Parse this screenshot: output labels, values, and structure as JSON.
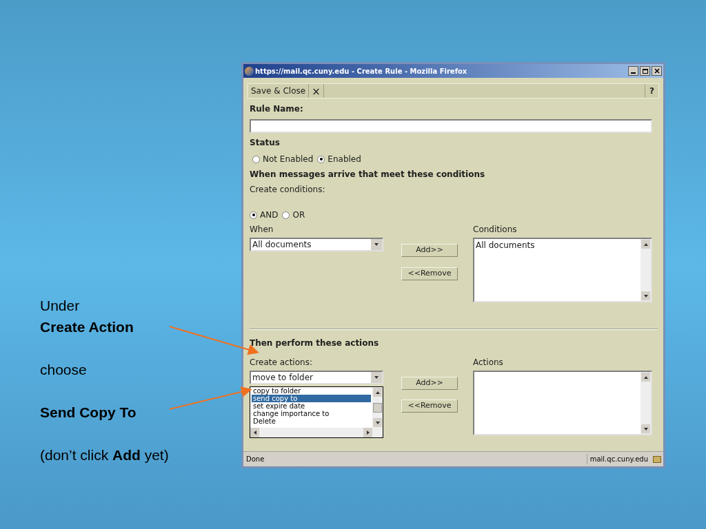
{
  "annotation": [
    {
      "kind": "plain",
      "text": "Under"
    },
    {
      "kind": "bold",
      "text": "Create Action"
    },
    {
      "kind": "gap"
    },
    {
      "kind": "plain",
      "text": "choose"
    },
    {
      "kind": "gap"
    },
    {
      "kind": "bold",
      "text": "Send Copy To"
    },
    {
      "kind": "gap"
    },
    {
      "kind": "plain",
      "text": "(don’t click **Add** yet)"
    }
  ],
  "window": {
    "title": "https://mail.qc.cuny.edu - Create Rule - Mozilla Firefox",
    "toolbar": {
      "save": "Save & Close",
      "close": "×",
      "help": "?"
    },
    "rule_name": {
      "label": "Rule Name:"
    },
    "status": {
      "label": "Status",
      "options": [
        {
          "label": "Not Enabled",
          "selected": false
        },
        {
          "label": "Enabled",
          "selected": true
        }
      ]
    },
    "conditions": {
      "heading": "When messages arrive that meet these conditions",
      "sublabel": "Create conditions:",
      "logic": [
        {
          "label": "AND",
          "selected": true
        },
        {
          "label": "OR",
          "selected": false
        }
      ],
      "when_label": "When",
      "when_value": "All documents",
      "add": "Add>>",
      "remove": "<<Remove",
      "list_label": "Conditions",
      "list_items": [
        "All documents"
      ]
    },
    "actions": {
      "heading": "Then perform these actions",
      "sublabel": "Create actions:",
      "select_value": "move to folder",
      "dropdown": [
        {
          "label": "copy to folder",
          "selected": false
        },
        {
          "label": "send copy to",
          "selected": true
        },
        {
          "label": "set expire date",
          "selected": false
        },
        {
          "label": "change importance to",
          "selected": false
        },
        {
          "label": "Delete",
          "selected": false
        }
      ],
      "add": "Add>>",
      "remove": "<<Remove",
      "list_label": "Actions"
    },
    "status_bar": {
      "text": "Done",
      "host": "mail.qc.cuny.edu"
    }
  }
}
